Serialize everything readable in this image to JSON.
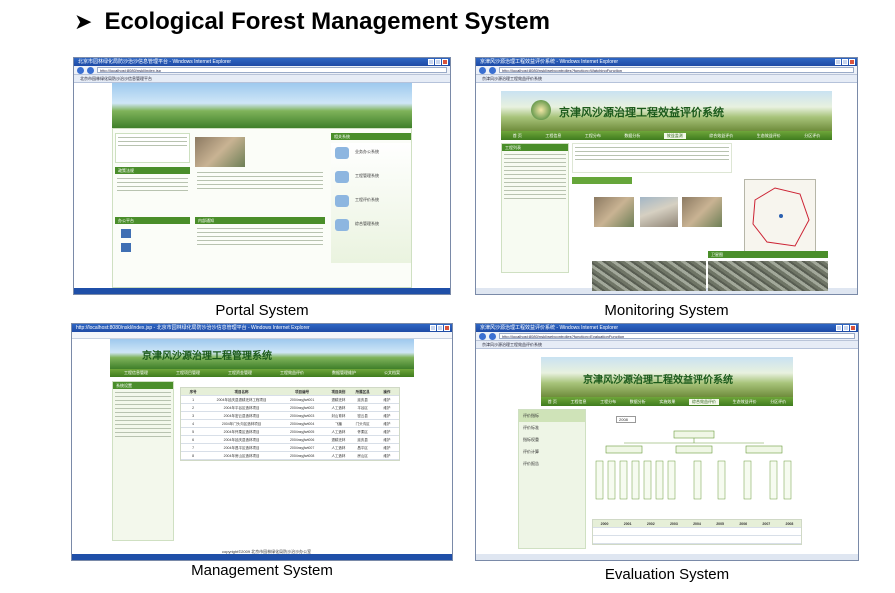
{
  "header": {
    "bullet_icon": "arrowhead-right-icon",
    "title": "Ecological Forest Management System"
  },
  "screenshots": {
    "portal": {
      "caption": "Portal System",
      "window_title": "北京市园林绿化局防沙治沙信息管理平台 - Windows Internet Explorer",
      "url": "http://localhost:8080/nskl/index.jsp",
      "tab": "北京市园林绿化局防沙治沙信息管理平台",
      "sections": [
        "政策法规",
        "办公平台",
        "内部通知",
        "相关系统"
      ],
      "systems": [
        "业务办公系统",
        "工程管理系统",
        "工程评价系统",
        "综合管理系统"
      ]
    },
    "monitoring": {
      "caption": "Monitoring System",
      "window_title": "京津风沙源治理工程效益评价系统 - Windows Internet Explorer",
      "url": "http://localhost:8080/nskl/webcontrolles?function=WatchingFunction",
      "tab": "京津风沙源治理工程效益评价系统",
      "banner_title": "京津风沙源治理工程效益评价系统",
      "nav": [
        "首 页",
        "工程信息",
        "工程分布",
        "数据分析",
        "效益监测",
        "综合效益评价",
        "生态效益评价",
        "分区评价"
      ],
      "active_nav": "效益监测",
      "tree_label": "工程列表",
      "sat_panel": "卫星图"
    },
    "management": {
      "caption": "Management System",
      "window_title": "http://localhost:8080/nskl/index.jsp - 北京市园林绿化局防沙治沙信息管理平台 - Windows Internet Explorer",
      "banner_title": "京津风沙源治理工程管理系统",
      "nav": [
        "工程信息管理",
        "工程项目管理",
        "工程资金管理",
        "工程效益评价",
        "数据管理维护",
        "公文档案"
      ],
      "left_panel": "系统设置",
      "table_headers": [
        "序号",
        "项目名称",
        "项目编号",
        "项目类别",
        "所属区县",
        "操作"
      ],
      "table_rows": [
        [
          "1",
          "2004年延庆县退耕还林工程项目",
          "2004nsyjfwt001",
          "退耕还林",
          "延庆县",
          "维护"
        ],
        [
          "2",
          "2004年平谷区造林项目",
          "2004nsyjfwt002",
          "人工造林",
          "平谷区",
          "维护"
        ],
        [
          "3",
          "2004年密云县造林项目",
          "2004nsyjfwt003",
          "封山育林",
          "密云县",
          "维护"
        ],
        [
          "4",
          "2004年门头沟区造林项目",
          "2004nsyjfwt004",
          "飞播",
          "门头沟区",
          "维护"
        ],
        [
          "5",
          "2004年怀柔区造林项目",
          "2004nsyjfwt005",
          "人工造林",
          "怀柔区",
          "维护"
        ],
        [
          "6",
          "2004年延庆县造林项目",
          "2004nsyjfwt006",
          "退耕还林",
          "延庆县",
          "维护"
        ],
        [
          "7",
          "2004年昌平区造林项目",
          "2004nsyjfwt007",
          "人工造林",
          "昌平区",
          "维护"
        ],
        [
          "8",
          "2004年房山区造林项目",
          "2004nsyjfwt008",
          "人工造林",
          "房山区",
          "维护"
        ]
      ],
      "footer": "copyright©2009 北京市园林绿化局防沙治沙办公室"
    },
    "evaluation": {
      "caption": "Evaluation System",
      "window_title": "京津风沙源治理工程效益评价系统 - Windows Internet Explorer",
      "url": "http://localhost:8080/nskl/webcontrolles?function=EvaluationFunction",
      "tab": "京津风沙源治理工程效益评价系统",
      "banner_title": "京津风沙源治理工程效益评价系统",
      "nav": [
        "首 页",
        "工程信息",
        "工程分布",
        "数据分析",
        "实施效果",
        "综合效益评价",
        "生态效益评价",
        "分区评价"
      ],
      "active_nav": "综合效益评价",
      "side_menu": [
        "评价指标",
        "评价标准",
        "指标权重",
        "评价计算",
        "评价报告"
      ],
      "year": "2008",
      "table_years": [
        "2000",
        "2001",
        "2002",
        "2003",
        "2004",
        "2005",
        "2006",
        "2007",
        "2008"
      ]
    }
  }
}
